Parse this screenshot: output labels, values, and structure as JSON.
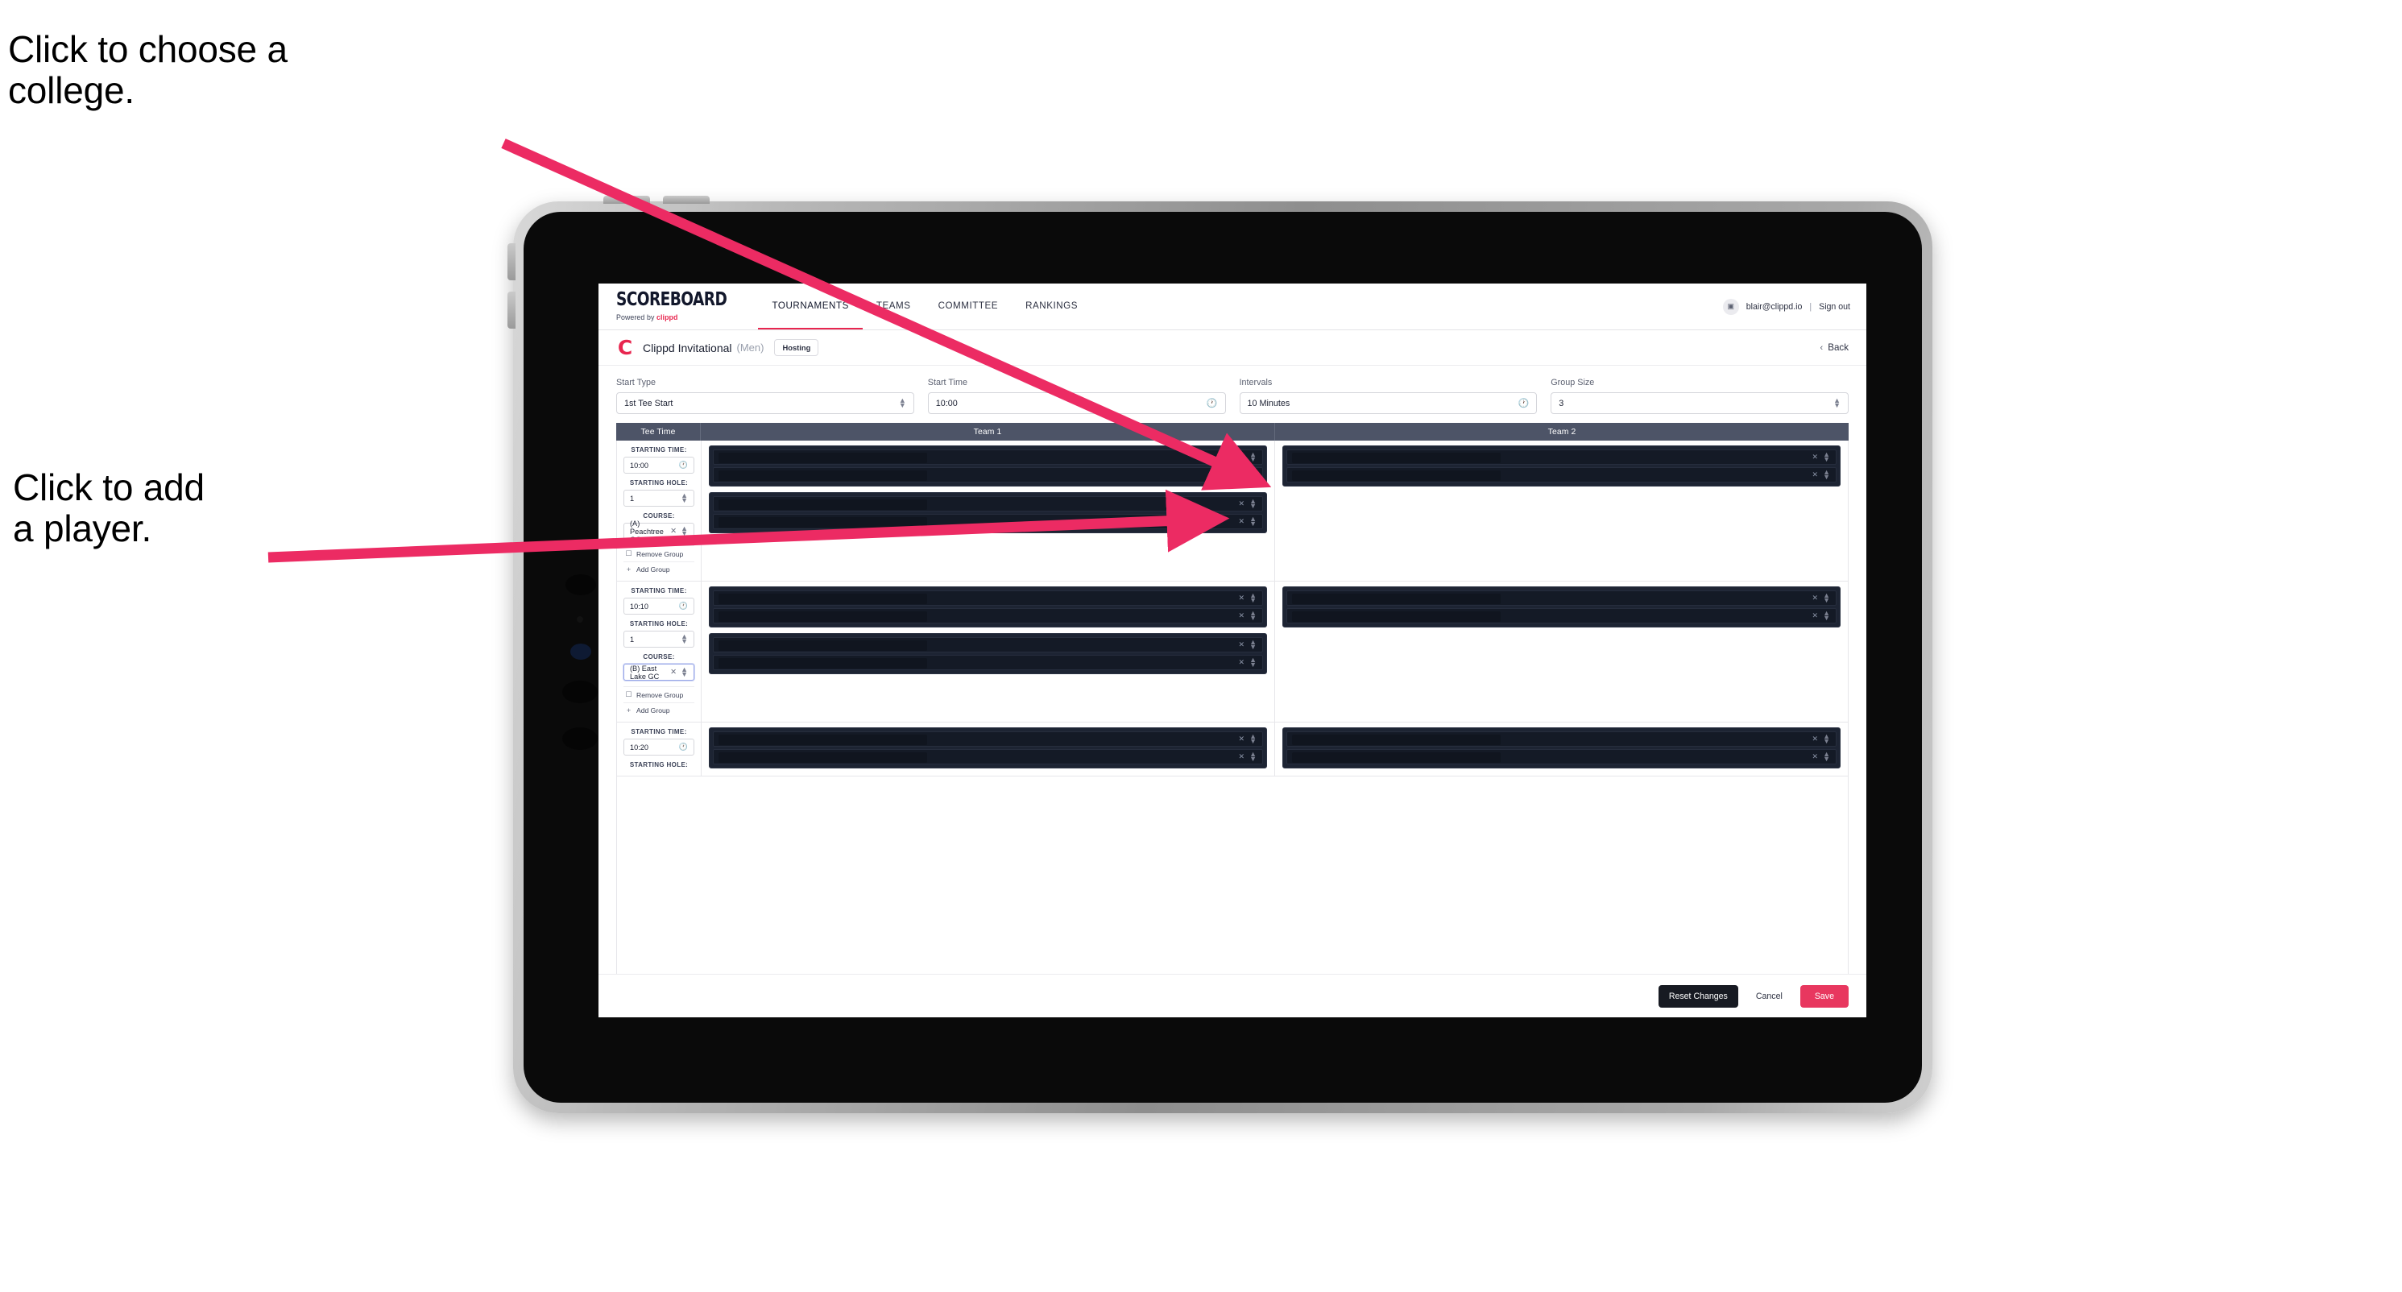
{
  "annotations": {
    "college": "Click to choose a\ncollege.",
    "player": "Click to add\na player.",
    "arrow_color": "#ec2b63"
  },
  "app": {
    "brand": {
      "title": "SCOREBOARD",
      "powered_prefix": "Powered by ",
      "powered_brand": "clippd"
    },
    "nav": [
      {
        "label": "TOURNAMENTS",
        "active": true
      },
      {
        "label": "TEAMS",
        "active": false
      },
      {
        "label": "COMMITTEE",
        "active": false
      },
      {
        "label": "RANKINGS",
        "active": false
      }
    ],
    "account": {
      "avatar_glyph": "▣",
      "email": "blair@clippd.io",
      "separator": "|",
      "sign_out": "Sign out"
    },
    "title_bar": {
      "logo_letter": "C",
      "tournament": "Clippd Invitational",
      "gender": "(Men)",
      "badge": "Hosting",
      "back_label": "Back",
      "back_chevron": "‹"
    },
    "controls": [
      {
        "label": "Start Type",
        "value": "1st Tee Start",
        "adorn": "spinner"
      },
      {
        "label": "Start Time",
        "value": "10:00",
        "adorn": "clock"
      },
      {
        "label": "Intervals",
        "value": "10 Minutes",
        "adorn": "clock"
      },
      {
        "label": "Group Size",
        "value": "3",
        "adorn": "spinner"
      }
    ],
    "table": {
      "headers": [
        "Tee Time",
        "Team 1",
        "Team 2"
      ],
      "field_labels": {
        "time": "STARTING TIME:",
        "hole": "STARTING HOLE:",
        "course": "COURSE:"
      },
      "group_actions": {
        "remove": "Remove Group",
        "add": "Add Group",
        "remove_icon": "☐",
        "add_icon": "+"
      },
      "rows": [
        {
          "starting_time": "10:00",
          "starting_hole": "1",
          "course": "(A) Peachtree GC",
          "course_focused": false,
          "team1_groups": [
            2,
            2
          ],
          "team2_groups": [
            2
          ]
        },
        {
          "starting_time": "10:10",
          "starting_hole": "1",
          "course": "(B) East Lake GC",
          "course_focused": true,
          "team1_groups": [
            2,
            2
          ],
          "team2_groups": [
            2
          ]
        },
        {
          "starting_time": "10:20",
          "starting_hole": "",
          "course": "",
          "course_focused": false,
          "team1_groups": [
            2
          ],
          "team2_groups": [
            2
          ]
        }
      ],
      "row_icons": {
        "remove": "✕",
        "reorder": "spinner"
      }
    },
    "footer": {
      "reset_label": "Reset Changes",
      "cancel_label": "Cancel",
      "save_label": "Save",
      "save_color": "#e8375f"
    }
  }
}
